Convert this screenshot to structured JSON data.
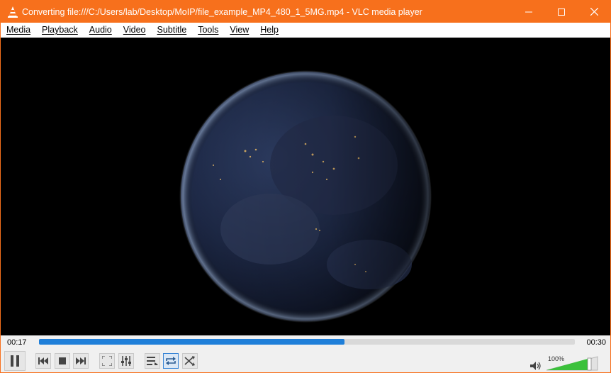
{
  "window": {
    "title": "Converting file:///C:/Users/lab/Desktop/MoIP/file_example_MP4_480_1_5MG.mp4 - VLC media player",
    "accent": "#f7701c"
  },
  "menu": {
    "items": [
      {
        "label": "Media",
        "name": "menu-media"
      },
      {
        "label": "Playback",
        "name": "menu-playback"
      },
      {
        "label": "Audio",
        "name": "menu-audio"
      },
      {
        "label": "Video",
        "name": "menu-video"
      },
      {
        "label": "Subtitle",
        "name": "menu-subtitle"
      },
      {
        "label": "Tools",
        "name": "menu-tools"
      },
      {
        "label": "View",
        "name": "menu-view"
      },
      {
        "label": "Help",
        "name": "menu-help"
      }
    ]
  },
  "playback": {
    "elapsed": "00:17",
    "total": "00:30",
    "progress": 0.57,
    "progress_color": "#1f7fd9"
  },
  "volume": {
    "level_label": "100%",
    "level": 1.0
  },
  "icons": {
    "pause": "pause-icon",
    "prev": "previous-icon",
    "stop": "stop-icon",
    "next": "next-icon",
    "fullscreen": "fullscreen-icon",
    "extended": "extended-settings-icon",
    "playlist": "playlist-icon",
    "loop": "loop-icon",
    "random": "shuffle-icon",
    "speaker": "speaker-icon"
  }
}
